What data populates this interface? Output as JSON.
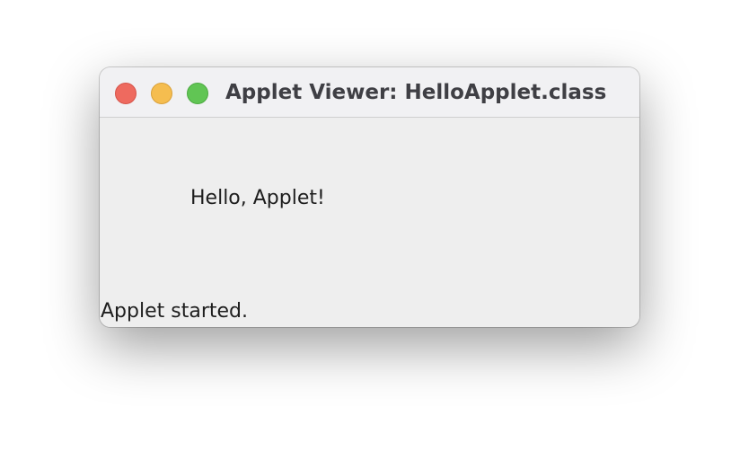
{
  "window": {
    "title": "Applet Viewer: HelloApplet.class",
    "controls": {
      "close_color": "#ee6a5f",
      "minimize_color": "#f5bd4f",
      "zoom_color": "#61c554"
    }
  },
  "applet": {
    "message": "Hello, Applet!"
  },
  "status_bar": {
    "text": "Applet started."
  }
}
